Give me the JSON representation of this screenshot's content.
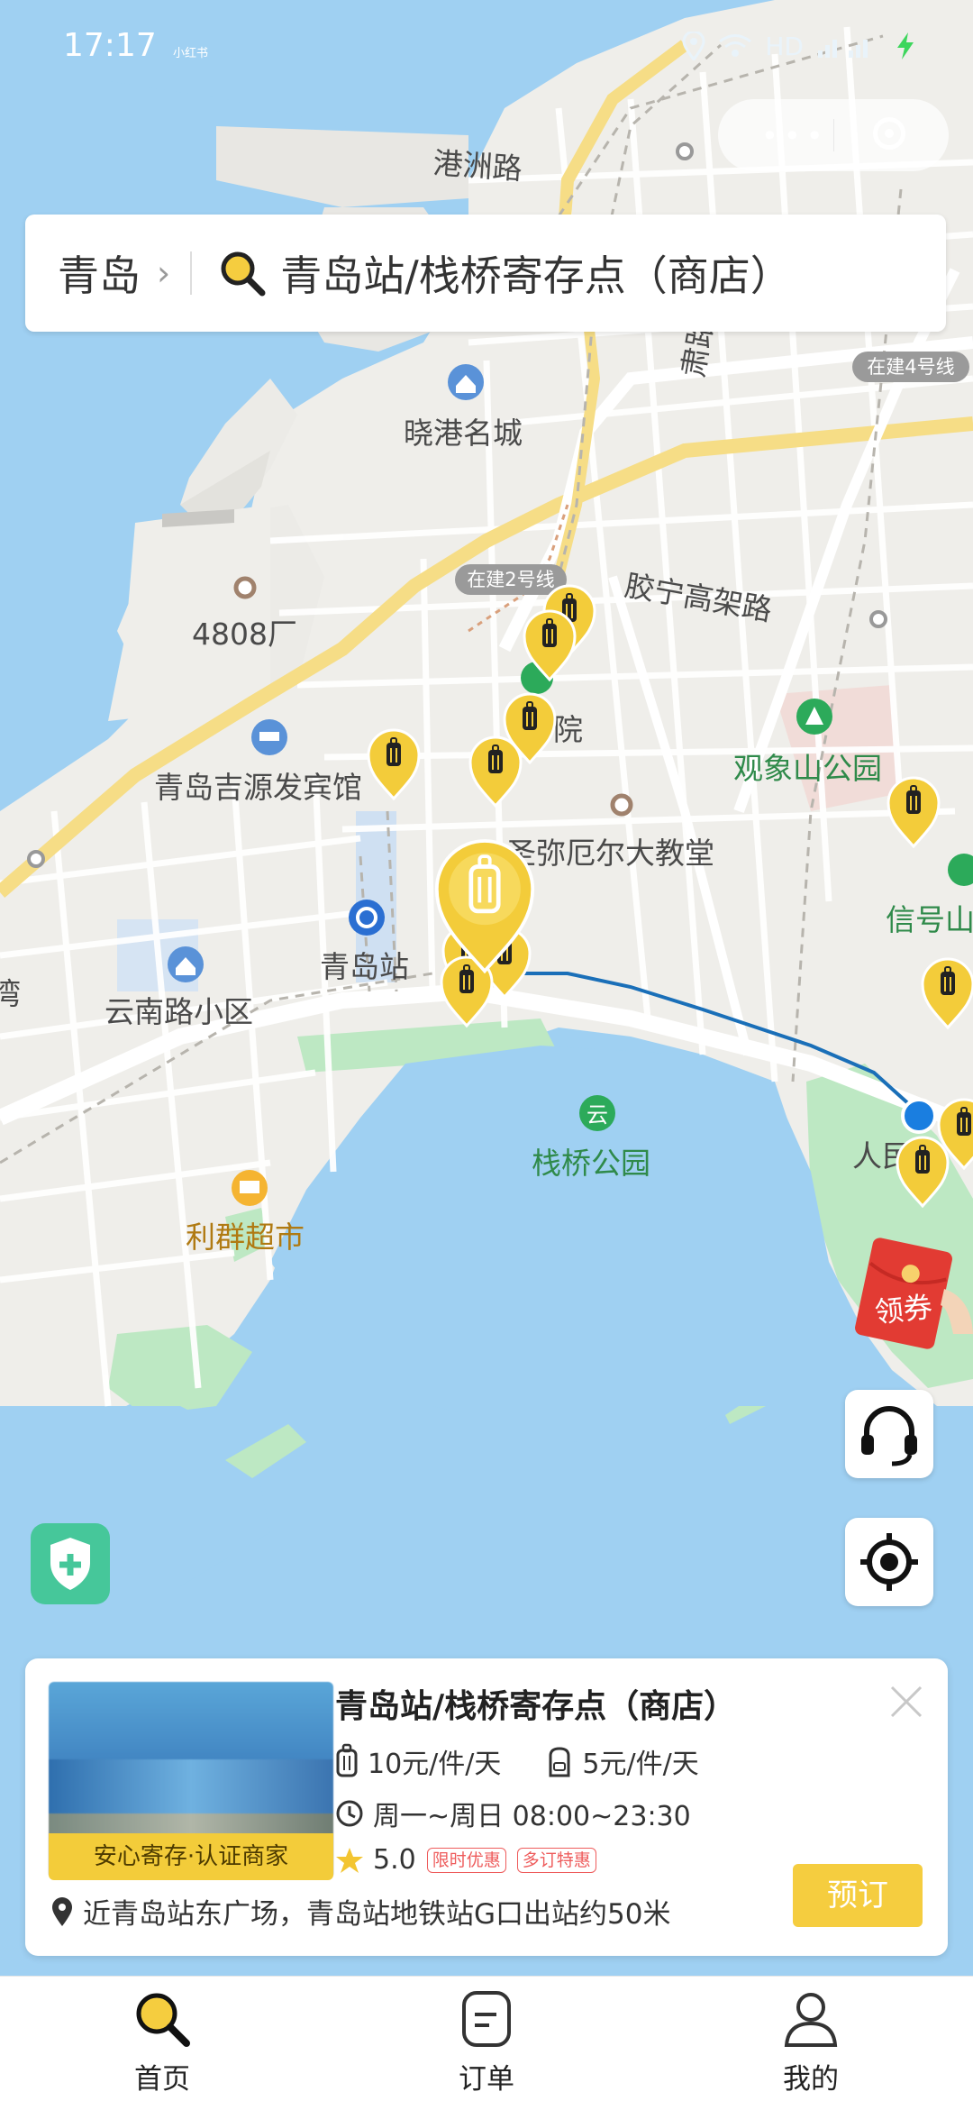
{
  "status_bar": {
    "time": "17:17",
    "carrier_tag": "小红书",
    "network": "HD",
    "battery_icon": "battery-charging-icon"
  },
  "map": {
    "labels": {
      "gangzhou_road": "港洲路",
      "xiaogang": "晓港名城",
      "factory": "4808厂",
      "hotel": "青岛吉源发宾馆",
      "station": "青岛站",
      "yunnan": "云南路小区",
      "liqun": "利群超市",
      "zhanqiao_park": "栈桥公园",
      "church": "圣弥厄尔大教堂",
      "guanxiang_park": "观象山公园",
      "signal_hill": "信号山",
      "jiaoning": "胶宁高架路",
      "line2": "在建2号线",
      "line4": "在建4号线",
      "yuan": "院",
      "people_square": "人民",
      "road_vertical": "肃路",
      "left_cut": "湾"
    },
    "land_color": "#efeeea",
    "water_color": "#9fd0f2"
  },
  "search": {
    "city": "青岛",
    "query": "青岛站/栈桥寄存点（商店）"
  },
  "floating": {
    "coupon_label": "领券",
    "support_icon": "headset-icon",
    "locate_icon": "locate-icon",
    "shield_icon": "shield-plus-icon"
  },
  "card": {
    "title": "青岛站/栈桥寄存点（商店）",
    "badge": "安心寄存·认证商家",
    "luggage_price": "10元/件/天",
    "bag_price": "5元/件/天",
    "hours": "周一~周日 08:00~23:30",
    "rating": "5.0",
    "tags": [
      "限时优惠",
      "多订特惠"
    ],
    "address": "近青岛站东广场，青岛站地铁站G口出站约50米",
    "book_label": "预订",
    "accent": "#f5cd3f"
  },
  "tabs": [
    {
      "label": "首页",
      "icon": "search-icon",
      "active": true
    },
    {
      "label": "订单",
      "icon": "order-icon",
      "active": false
    },
    {
      "label": "我的",
      "icon": "user-icon",
      "active": false
    }
  ]
}
